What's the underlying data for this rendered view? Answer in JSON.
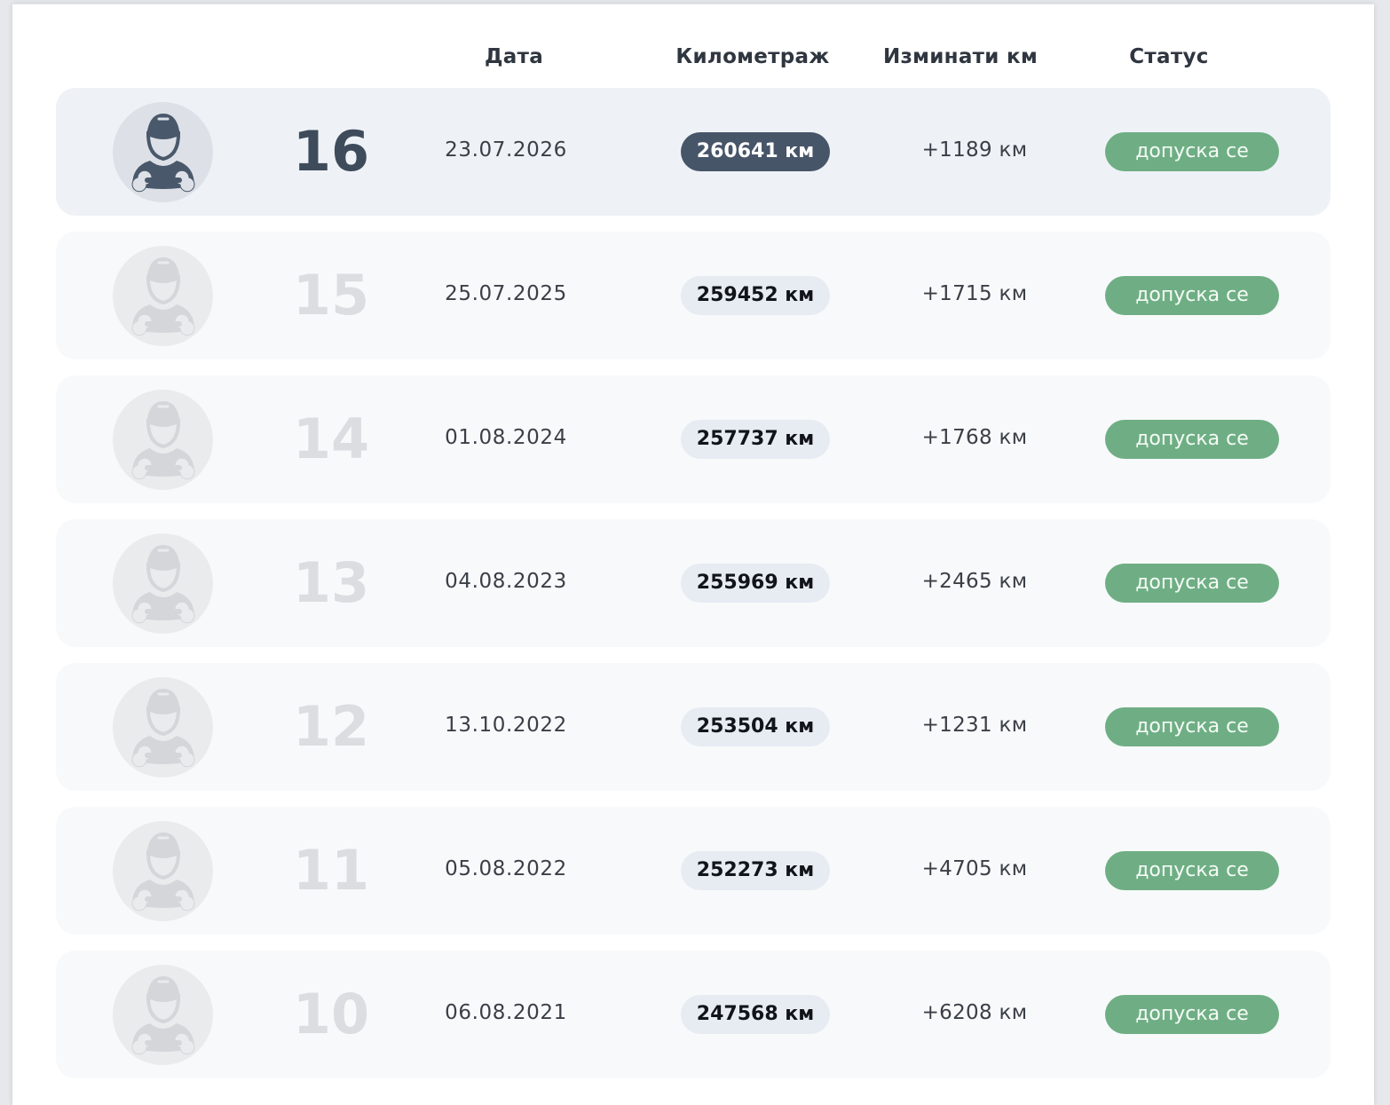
{
  "header": {
    "date_label": "Дата",
    "mileage_label": "Километраж",
    "delta_label": "Изминати км",
    "status_label": "Статус"
  },
  "rows": [
    {
      "num": "16",
      "date": "23.07.2026",
      "km": "260641 км",
      "delta": "+1189 км",
      "status": "допуска се",
      "active": true
    },
    {
      "num": "15",
      "date": "25.07.2025",
      "km": "259452 км",
      "delta": "+1715 км",
      "status": "допуска се",
      "active": false
    },
    {
      "num": "14",
      "date": "01.08.2024",
      "km": "257737 км",
      "delta": "+1768 км",
      "status": "допуска се",
      "active": false
    },
    {
      "num": "13",
      "date": "04.08.2023",
      "km": "255969 км",
      "delta": "+2465 км",
      "status": "допуска се",
      "active": false
    },
    {
      "num": "12",
      "date": "13.10.2022",
      "km": "253504 км",
      "delta": "+1231 км",
      "status": "допуска се",
      "active": false
    },
    {
      "num": "11",
      "date": "05.08.2022",
      "km": "252273 км",
      "delta": "+4705 км",
      "status": "допуска се",
      "active": false
    },
    {
      "num": "10",
      "date": "06.08.2021",
      "km": "247568 км",
      "delta": "+6208 км",
      "status": "допуска се",
      "active": false
    }
  ],
  "icons": {
    "avatar": "mechanic-icon"
  },
  "colors": {
    "status_green": "#6fae84",
    "active_row": "#eef2f7",
    "active_km": "#475568",
    "km_pill": "#e7ecf3"
  }
}
